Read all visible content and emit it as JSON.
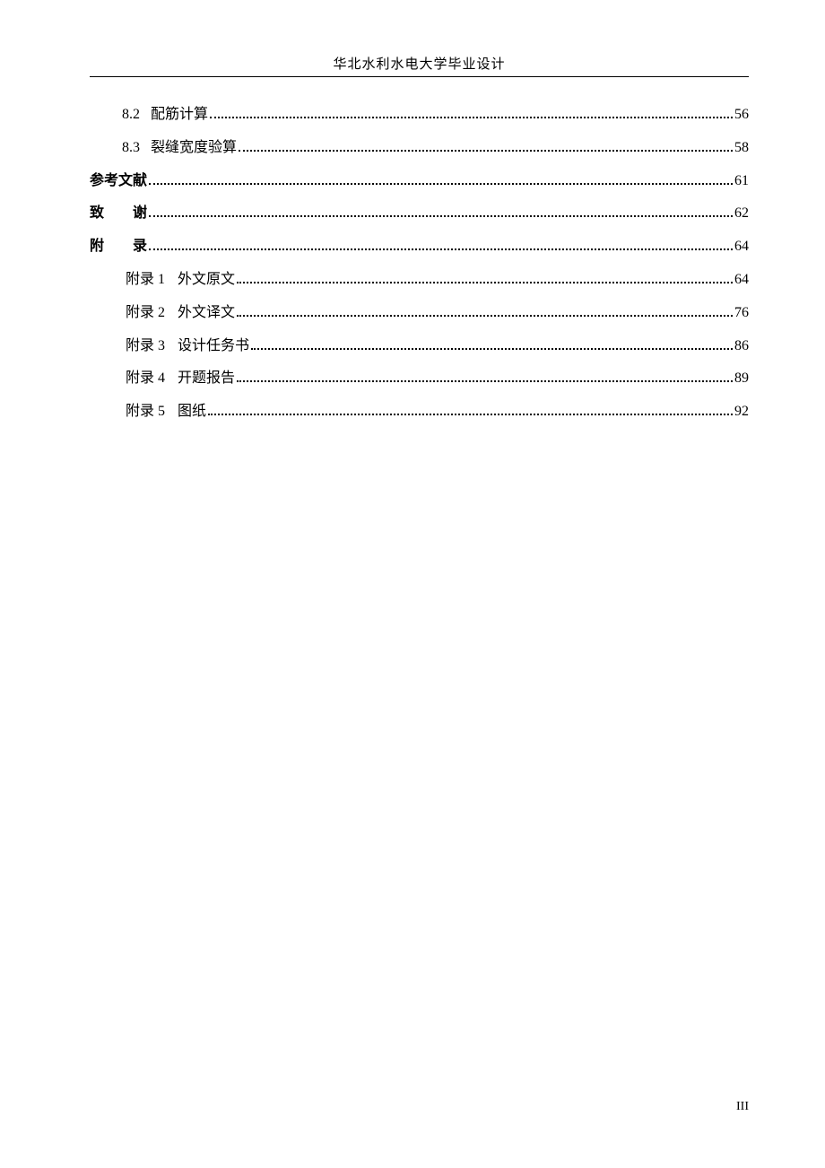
{
  "header": {
    "title": "华北水利水电大学毕业设计"
  },
  "toc": {
    "entries": [
      {
        "level": 1,
        "prefix": "8.2",
        "title": "配筋计算",
        "page": "56"
      },
      {
        "level": 1,
        "prefix": "8.3",
        "title": "裂缝宽度验算",
        "page": "58"
      },
      {
        "level": 0,
        "prefix": "",
        "title": "参考文献",
        "page": "61",
        "spaced": false
      },
      {
        "level": 0,
        "prefix": "",
        "title": "致　　谢",
        "page": "62",
        "spaced": true
      },
      {
        "level": 0,
        "prefix": "",
        "title": "附　　录",
        "page": "64",
        "spaced": true
      },
      {
        "level": 2,
        "prefix": "附录 1",
        "title": "外文原文",
        "page": "64"
      },
      {
        "level": 2,
        "prefix": "附录 2",
        "title": "外文译文",
        "page": "76"
      },
      {
        "level": 2,
        "prefix": "附录 3",
        "title": "设计任务书",
        "page": "86"
      },
      {
        "level": 2,
        "prefix": "附录 4",
        "title": "开题报告",
        "page": "89"
      },
      {
        "level": 2,
        "prefix": "附录 5",
        "title": "图纸",
        "page": "92"
      }
    ]
  },
  "footer": {
    "pageNumber": "III"
  }
}
